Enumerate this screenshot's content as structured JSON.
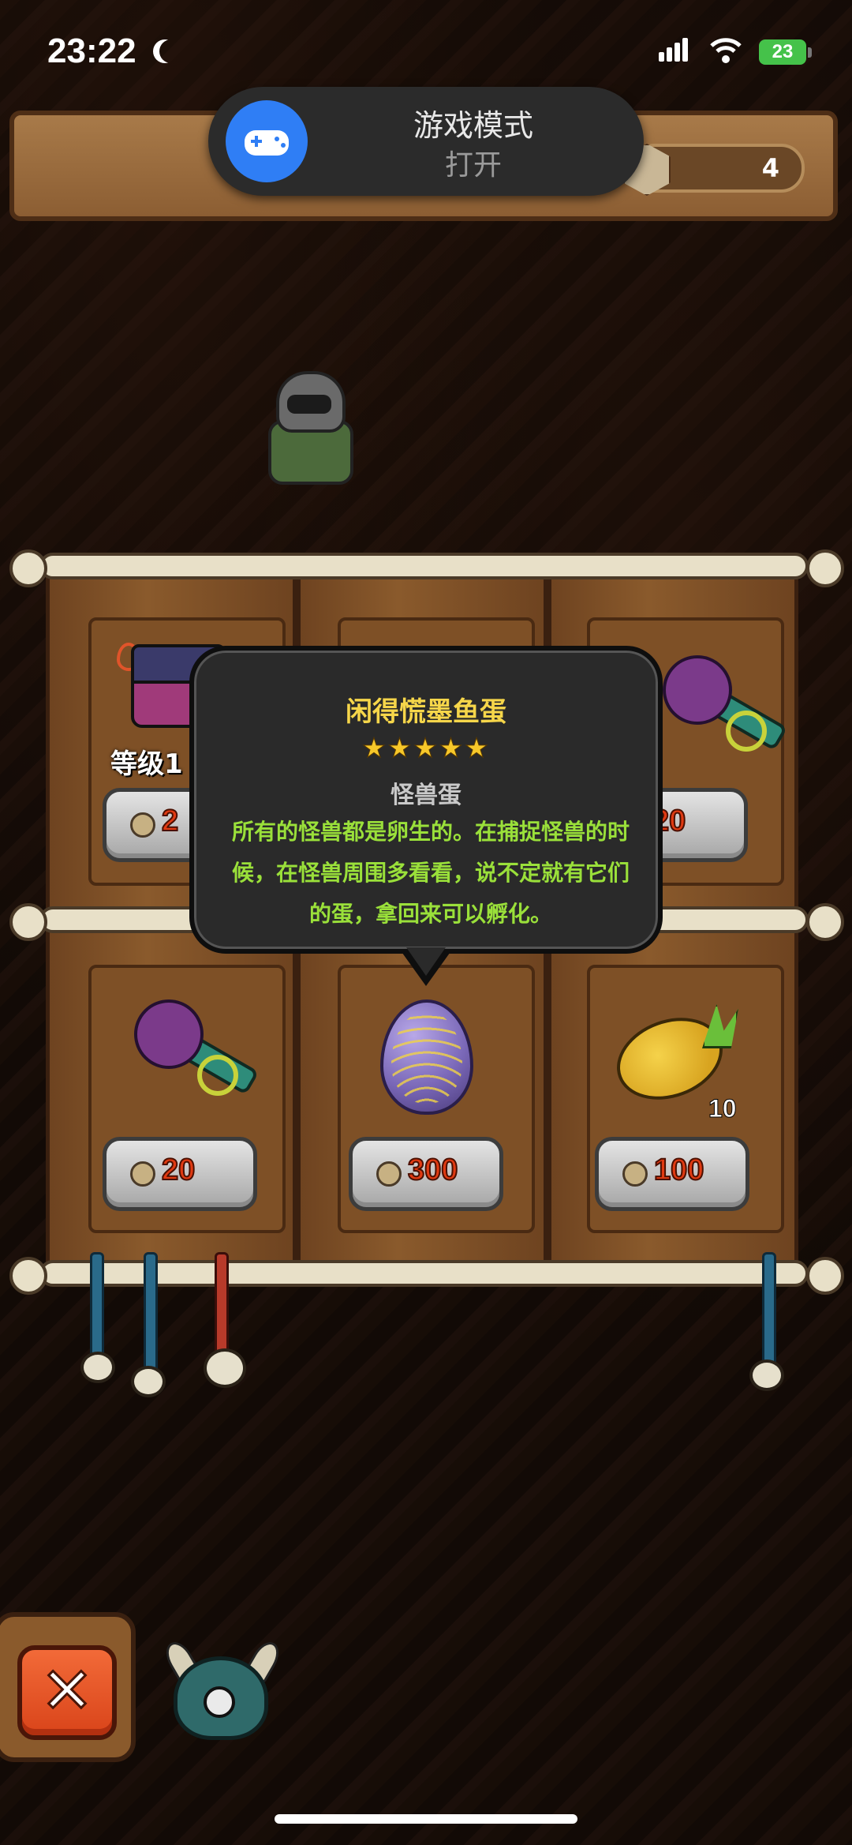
{
  "status_bar": {
    "time": "23:22",
    "battery": "23"
  },
  "game_mode_toast": {
    "title": "游戏模式",
    "state": "打开"
  },
  "top_bar": {
    "currency_count": "4"
  },
  "shop": {
    "slots": [
      {
        "item": "monster-chest",
        "level_label": "等级1",
        "price": "2",
        "partially_hidden": true
      },
      {
        "item": "hidden",
        "price": ""
      },
      {
        "item": "spiked-club",
        "price": "20"
      },
      {
        "item": "spiked-club",
        "price": "20"
      },
      {
        "item": "monster-egg",
        "price": "300"
      },
      {
        "item": "pineapple",
        "price": "100",
        "quantity": "10"
      }
    ]
  },
  "tooltip": {
    "title": "闲得慌墨鱼蛋",
    "stars": "★★★★★",
    "star_count": 5,
    "type": "怪兽蛋",
    "description": "所有的怪兽都是卵生的。在捕捉怪兽的时候，在怪兽周围多看看，说不定就有它们的蛋，拿回来可以孵化。"
  },
  "colors": {
    "accent_price": "#e03a12",
    "tooltip_title": "#f6d64a",
    "tooltip_desc": "#9ae03a",
    "close_button": "#e35a2a"
  }
}
